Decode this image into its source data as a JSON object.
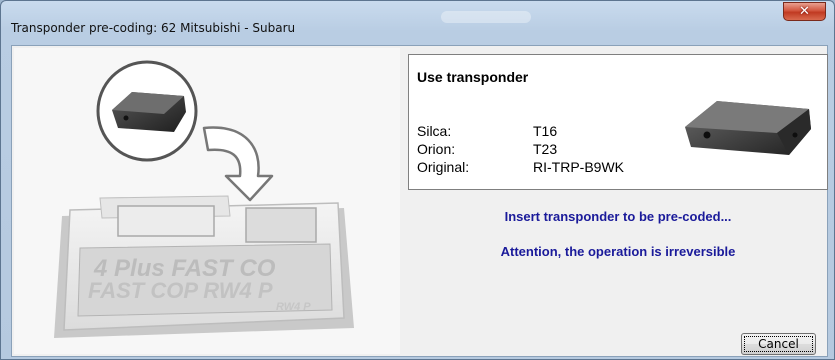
{
  "window": {
    "title": "Transponder pre-coding: 62 Mitsubishi - Subaru",
    "close_glyph": "✕"
  },
  "info": {
    "heading": "Use transponder",
    "rows": [
      {
        "label": "Silca:",
        "value": "T16"
      },
      {
        "label": "Orion:",
        "value": "T23"
      },
      {
        "label": "Original:",
        "value": "RI-TRP-B9WK"
      }
    ]
  },
  "messages": {
    "insert": "Insert transponder to be pre-coded...",
    "attention": "Attention, the operation is irreversible"
  },
  "buttons": {
    "cancel": "Cancel"
  },
  "illustration": {
    "device_text_1": "4 Plus FAST CO",
    "device_text_2": "FAST COP RW4 P",
    "device_text_3": "RW4 P"
  },
  "colors": {
    "message": "#1a1a9a",
    "close": "#c03a22"
  }
}
